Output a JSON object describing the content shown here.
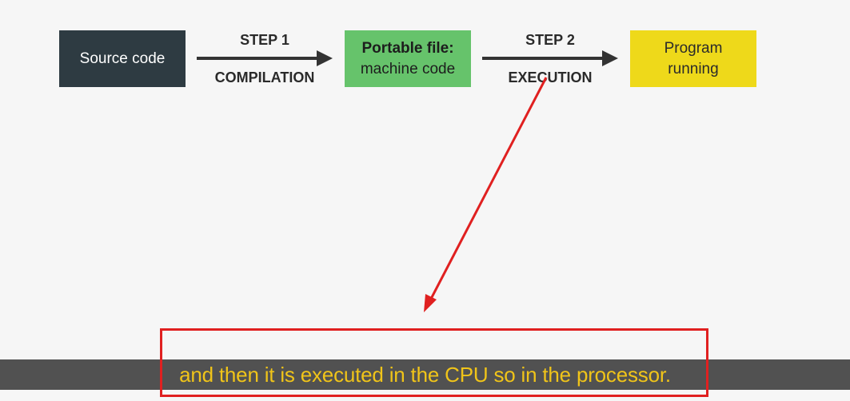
{
  "diagram": {
    "source_box": {
      "label": "Source code",
      "color": "#2e3b42"
    },
    "step1": {
      "title": "STEP 1",
      "subtitle": "COMPILATION"
    },
    "portable_box": {
      "line1": "Portable file:",
      "line2": "machine code",
      "color": "#66c36b"
    },
    "step2": {
      "title": "STEP 2",
      "subtitle": "EXECUTION"
    },
    "program_box": {
      "line1": "Program",
      "line2": "running",
      "color": "#eed91a"
    },
    "arrow_color": "#333333"
  },
  "annotation": {
    "color": "#e02020"
  },
  "caption": {
    "text": "and then it is executed in the CPU so in the processor.",
    "text_color": "#f0c419",
    "bar_color": "#484848"
  }
}
